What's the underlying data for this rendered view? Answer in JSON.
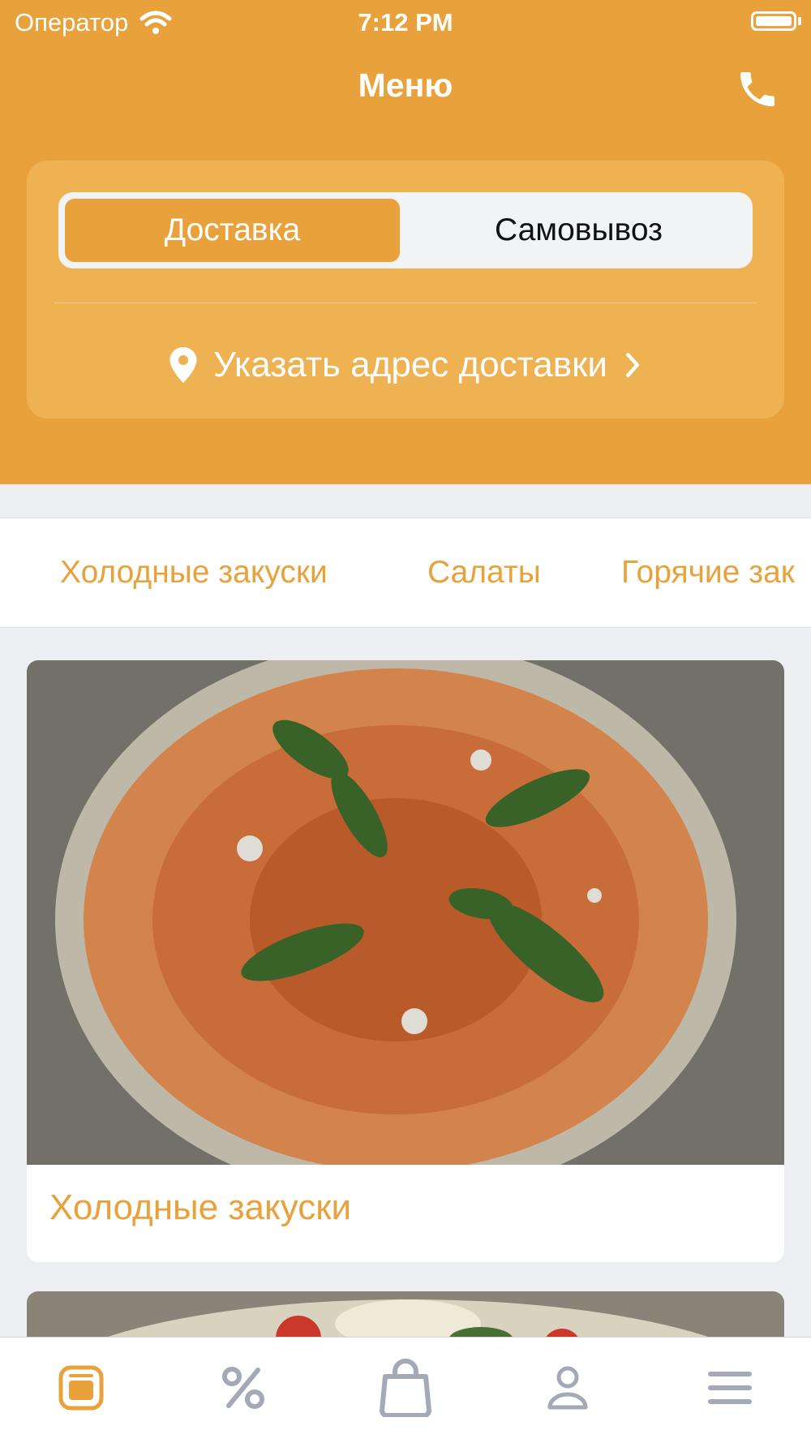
{
  "status_bar": {
    "carrier": "Оператор",
    "time": "7:12 PM"
  },
  "header": {
    "title": "Меню",
    "phone_icon": "phone-icon"
  },
  "delivery": {
    "options": [
      {
        "label": "Доставка",
        "selected": true
      },
      {
        "label": "Самовывоз",
        "selected": false
      }
    ],
    "address_prompt": "Указать адрес доставки"
  },
  "category_tabs": [
    "Холодные закуски",
    "Салаты",
    "Горячие зак"
  ],
  "categories": [
    {
      "title": "Холодные закуски",
      "image": "salmon-carpaccio-photo"
    },
    {
      "title": "",
      "image": "salad-photo"
    }
  ],
  "tab_bar": [
    {
      "name": "menu",
      "icon": "menu-tab-icon",
      "active": true
    },
    {
      "name": "promotions",
      "icon": "percent-icon",
      "active": false
    },
    {
      "name": "cart",
      "icon": "shopping-bag-icon",
      "active": false
    },
    {
      "name": "profile",
      "icon": "user-icon",
      "active": false
    },
    {
      "name": "more",
      "icon": "hamburger-icon",
      "active": false
    }
  ],
  "colors": {
    "accent": "#e9a23b",
    "background": "#eceef2",
    "inactive_icon": "#a3a9b6"
  }
}
